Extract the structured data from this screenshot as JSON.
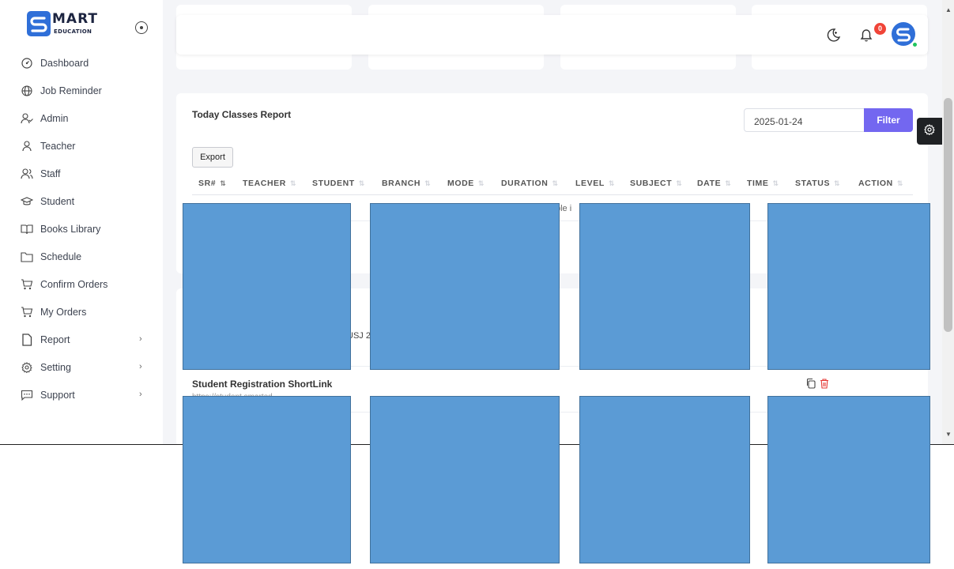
{
  "brand": {
    "title": "MART",
    "subtitle": "EDUCATION"
  },
  "sidebar": {
    "items": [
      {
        "label": "Dashboard",
        "icon": "dashboard-icon",
        "has_submenu": false
      },
      {
        "label": "Job Reminder",
        "icon": "globe-icon",
        "has_submenu": false
      },
      {
        "label": "Admin",
        "icon": "user-check-icon",
        "has_submenu": false
      },
      {
        "label": "Teacher",
        "icon": "user-icon",
        "has_submenu": false
      },
      {
        "label": "Staff",
        "icon": "users-icon",
        "has_submenu": false
      },
      {
        "label": "Student",
        "icon": "graduation-cap-icon",
        "has_submenu": false
      },
      {
        "label": "Books Library",
        "icon": "book-icon",
        "has_submenu": false
      },
      {
        "label": "Schedule",
        "icon": "folder-icon",
        "has_submenu": false
      },
      {
        "label": "Confirm Orders",
        "icon": "cart-icon",
        "has_submenu": false
      },
      {
        "label": "My Orders",
        "icon": "cart-icon",
        "has_submenu": false
      },
      {
        "label": "Report",
        "icon": "file-icon",
        "has_submenu": true
      },
      {
        "label": "Setting",
        "icon": "settings-icon",
        "has_submenu": true
      },
      {
        "label": "Support",
        "icon": "chat-icon",
        "has_submenu": true
      }
    ],
    "chevron": "›"
  },
  "topbar": {
    "notification_count": "0"
  },
  "report": {
    "title": "Today Classes Report",
    "date_value": "2025-01-24",
    "filter_label": "Filter",
    "export_label": "Export",
    "columns": [
      "SR#",
      "TEACHER",
      "STUDENT",
      "BRANCH",
      "MODE",
      "DURATION",
      "LEVEL",
      "SUBJECT",
      "DATE",
      "TIME",
      "STATUS",
      "ACTION"
    ],
    "empty_partial": "ble i"
  },
  "shortlinks": {
    "partial_text": "USJ 2",
    "row_title": "Student Registration ShortLink",
    "row_url": "https://student.smarted..."
  },
  "colors": {
    "accent": "#7367f0",
    "brand": "#2f6fd8",
    "badge": "#f04438",
    "redaction": "#5b9bd5"
  }
}
